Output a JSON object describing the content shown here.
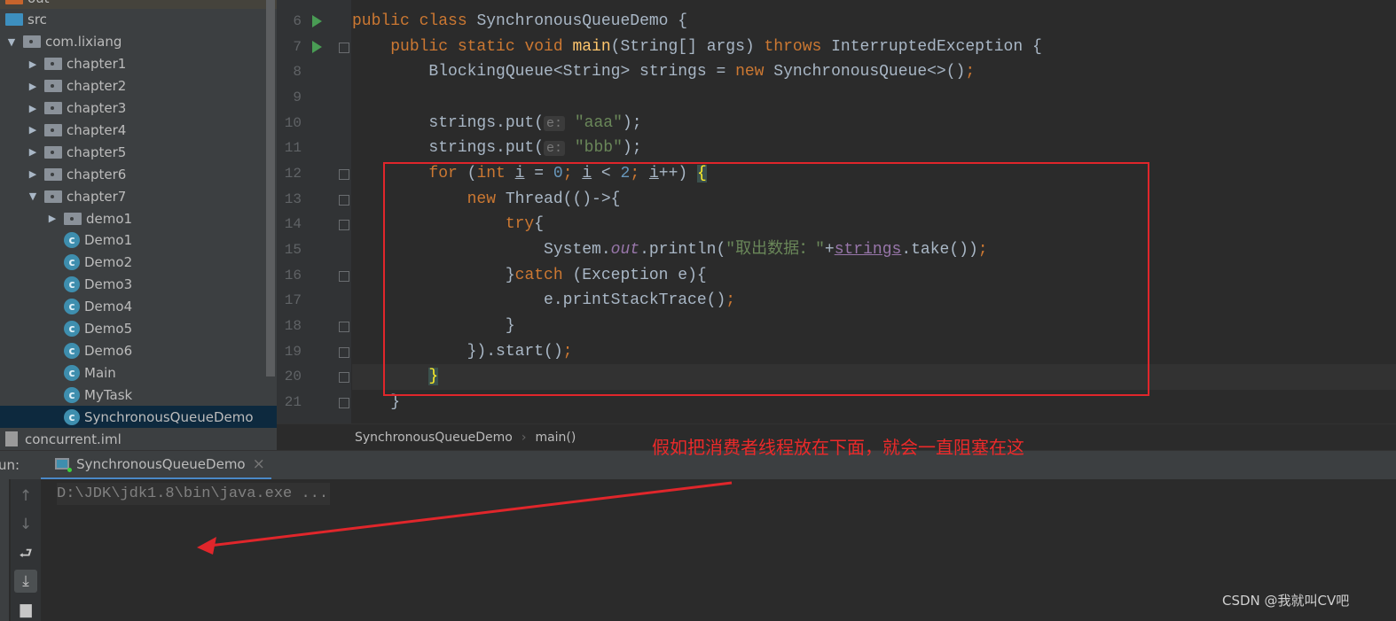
{
  "project_tree": [
    {
      "label": "out",
      "depth": 0,
      "arrow": "",
      "icon": "orange-folder-icon"
    },
    {
      "label": "src",
      "depth": 0,
      "arrow": "",
      "icon": "source-folder-icon"
    },
    {
      "label": "com.lixiang",
      "depth": 0,
      "arrow": "▼",
      "icon": "package-icon"
    },
    {
      "label": "chapter1",
      "depth": 1,
      "arrow": "▶",
      "icon": "package-icon"
    },
    {
      "label": "chapter2",
      "depth": 1,
      "arrow": "▶",
      "icon": "package-icon"
    },
    {
      "label": "chapter3",
      "depth": 1,
      "arrow": "▶",
      "icon": "package-icon"
    },
    {
      "label": "chapter4",
      "depth": 1,
      "arrow": "▶",
      "icon": "package-icon"
    },
    {
      "label": "chapter5",
      "depth": 1,
      "arrow": "▶",
      "icon": "package-icon"
    },
    {
      "label": "chapter6",
      "depth": 1,
      "arrow": "▶",
      "icon": "package-icon"
    },
    {
      "label": "chapter7",
      "depth": 1,
      "arrow": "▼",
      "icon": "package-icon"
    },
    {
      "label": "demo1",
      "depth": 2,
      "arrow": "▶",
      "icon": "package-icon"
    },
    {
      "label": "Demo1",
      "depth": 2,
      "arrow": "",
      "icon": "class-icon"
    },
    {
      "label": "Demo2",
      "depth": 2,
      "arrow": "",
      "icon": "class-icon"
    },
    {
      "label": "Demo3",
      "depth": 2,
      "arrow": "",
      "icon": "class-icon"
    },
    {
      "label": "Demo4",
      "depth": 2,
      "arrow": "",
      "icon": "class-icon"
    },
    {
      "label": "Demo5",
      "depth": 2,
      "arrow": "",
      "icon": "class-icon"
    },
    {
      "label": "Demo6",
      "depth": 2,
      "arrow": "",
      "icon": "class-icon"
    },
    {
      "label": "Main",
      "depth": 2,
      "arrow": "",
      "icon": "class-icon"
    },
    {
      "label": "MyTask",
      "depth": 2,
      "arrow": "",
      "icon": "class-icon"
    },
    {
      "label": "SynchronousQueueDemo",
      "depth": 2,
      "arrow": "",
      "icon": "class-icon",
      "selected": true
    },
    {
      "label": "concurrent.iml",
      "depth": -1,
      "arrow": "",
      "icon": "file-icon"
    }
  ],
  "code_lines": [
    {
      "n": "6",
      "run": true,
      "fold": false,
      "tokens": [
        [
          "public class ",
          "kw"
        ],
        [
          "SynchronousQueueDemo {",
          ""
        ]
      ]
    },
    {
      "n": "7",
      "run": true,
      "fold": true,
      "tokens": [
        [
          "    ",
          ""
        ],
        [
          "public static void ",
          "kw"
        ],
        [
          "main",
          "fn"
        ],
        [
          "(String[] args) ",
          ""
        ],
        [
          "throws ",
          "kw"
        ],
        [
          "InterruptedException {",
          ""
        ]
      ]
    },
    {
      "n": "8",
      "tokens": [
        [
          "        BlockingQueue<String> strings = ",
          ""
        ],
        [
          "new ",
          "kw"
        ],
        [
          "SynchronousQueue<>()",
          ""
        ],
        [
          ";",
          "kw"
        ]
      ]
    },
    {
      "n": "9",
      "tokens": []
    },
    {
      "n": "10",
      "tokens": [
        [
          "        strings.put(",
          ""
        ],
        [
          "e:",
          "hint"
        ],
        [
          " ",
          ""
        ],
        [
          "\"aaa\"",
          "str"
        ],
        [
          ");",
          ""
        ]
      ]
    },
    {
      "n": "11",
      "tokens": [
        [
          "        strings.put(",
          ""
        ],
        [
          "e:",
          "hint"
        ],
        [
          " ",
          ""
        ],
        [
          "\"bbb\"",
          "str"
        ],
        [
          ");",
          ""
        ]
      ]
    },
    {
      "n": "12",
      "fold": true,
      "tokens": [
        [
          "        ",
          ""
        ],
        [
          "for ",
          "kw"
        ],
        [
          "(",
          ""
        ],
        [
          "int ",
          "kw"
        ],
        [
          "i",
          "ul"
        ],
        [
          " = ",
          ""
        ],
        [
          "0",
          "num"
        ],
        [
          "; ",
          "kw"
        ],
        [
          "i",
          "ul"
        ],
        [
          " < ",
          ""
        ],
        [
          "2",
          "num"
        ],
        [
          "; ",
          "kw"
        ],
        [
          "i",
          "ul"
        ],
        [
          "++) ",
          ""
        ],
        [
          "{",
          "brace"
        ]
      ]
    },
    {
      "n": "13",
      "fold": true,
      "tokens": [
        [
          "            ",
          ""
        ],
        [
          "new ",
          "kw"
        ],
        [
          "Thread(()->{",
          ""
        ]
      ]
    },
    {
      "n": "14",
      "fold": true,
      "tokens": [
        [
          "                ",
          ""
        ],
        [
          "try",
          "kw"
        ],
        [
          "{",
          ""
        ]
      ]
    },
    {
      "n": "15",
      "tokens": [
        [
          "                    System.",
          ""
        ],
        [
          "out",
          "st"
        ],
        [
          ".println(",
          ""
        ],
        [
          "\"取出数据：\"",
          "str"
        ],
        [
          "+",
          ""
        ],
        [
          "strings",
          "fld"
        ],
        [
          ".take())",
          ""
        ],
        [
          ";",
          "kw"
        ]
      ]
    },
    {
      "n": "16",
      "fold": true,
      "tokens": [
        [
          "                }",
          ""
        ],
        [
          "catch ",
          "kw"
        ],
        [
          "(Exception e){",
          ""
        ]
      ]
    },
    {
      "n": "17",
      "tokens": [
        [
          "                    e.printStackTrace()",
          ""
        ],
        [
          ";",
          "kw"
        ]
      ]
    },
    {
      "n": "18",
      "fold": true,
      "tokens": [
        [
          "                }",
          ""
        ]
      ]
    },
    {
      "n": "19",
      "fold": true,
      "tokens": [
        [
          "            }).start()",
          ""
        ],
        [
          ";",
          "kw"
        ]
      ]
    },
    {
      "n": "20",
      "fold": true,
      "current": true,
      "tokens": [
        [
          "        ",
          ""
        ],
        [
          "}",
          "brace"
        ]
      ]
    },
    {
      "n": "21",
      "fold": true,
      "tokens": [
        [
          "    }",
          ""
        ]
      ]
    }
  ],
  "breadcrumb": {
    "class": "SynchronousQueueDemo",
    "method": "main()"
  },
  "run_panel": {
    "label": "un:",
    "tab": "SynchronousQueueDemo",
    "close": "×",
    "command": "D:\\JDK\\jdk1.8\\bin\\java.exe ..."
  },
  "annotation": {
    "text": "假如把消费者线程放在下面，就会一直阻塞在这",
    "color": "#ec2a2a"
  },
  "watermark": "CSDN @我就叫CV吧"
}
